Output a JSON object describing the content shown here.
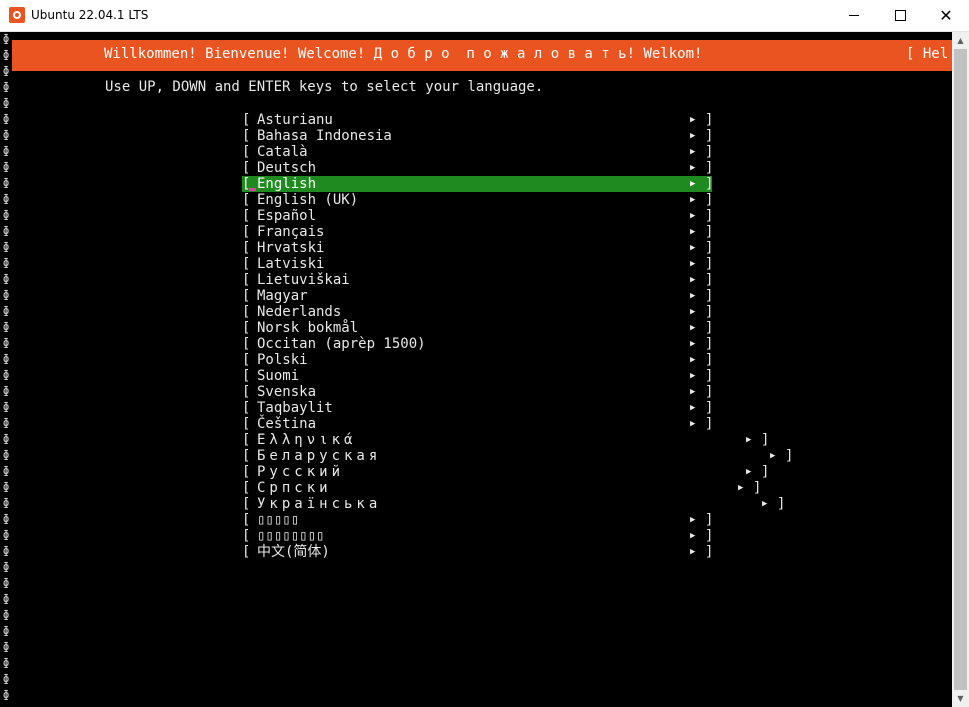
{
  "window": {
    "title": "Ubuntu 22.04.1 LTS",
    "minimize_label": "Minimize",
    "maximize_label": "Maximize",
    "close_label": "Close"
  },
  "banner": {
    "welcome": "Willkommen! Bienvenue! Welcome! Д о б р о  п о ж а л о в а т ь! Welkom!",
    "help": "[ Hel"
  },
  "instruction": "Use UP, DOWN and ENTER keys to select your language.",
  "languages": [
    {
      "label": "Asturianu",
      "selected": false
    },
    {
      "label": "Bahasa Indonesia",
      "selected": false
    },
    {
      "label": "Català",
      "selected": false
    },
    {
      "label": "Deutsch",
      "selected": false
    },
    {
      "label": "English",
      "selected": true
    },
    {
      "label": "English (UK)",
      "selected": false
    },
    {
      "label": "Español",
      "selected": false
    },
    {
      "label": "Français",
      "selected": false
    },
    {
      "label": "Hrvatski",
      "selected": false
    },
    {
      "label": "Latviski",
      "selected": false
    },
    {
      "label": "Lietuviškai",
      "selected": false
    },
    {
      "label": "Magyar",
      "selected": false
    },
    {
      "label": "Nederlands",
      "selected": false
    },
    {
      "label": "Norsk bokmål",
      "selected": false
    },
    {
      "label": "Occitan (aprèp 1500)",
      "selected": false
    },
    {
      "label": "Polski",
      "selected": false
    },
    {
      "label": "Suomi",
      "selected": false
    },
    {
      "label": "Svenska",
      "selected": false
    },
    {
      "label": "Taqbaylit",
      "selected": false
    },
    {
      "label": "Čeština",
      "selected": false
    },
    {
      "label": "Ελληνικά",
      "selected": false
    },
    {
      "label": "Беларуская",
      "selected": false
    },
    {
      "label": "Русский",
      "selected": false
    },
    {
      "label": "Српски",
      "selected": false
    },
    {
      "label": "Українська",
      "selected": false
    },
    {
      "label": "▯▯▯▯▯",
      "selected": false
    },
    {
      "label": "▯▯▯▯▯▯▯▯",
      "selected": false
    },
    {
      "label": "中文(简体)",
      "selected": false
    }
  ],
  "item_open_bracket": "[",
  "item_close_bracket": "]",
  "item_arrow": "▶",
  "gutter_glyph": "ɸ",
  "colors": {
    "banner": "#e95420",
    "selected": "#1f8a1f",
    "cursor": "#e040a0",
    "terminal_bg": "#000000"
  }
}
